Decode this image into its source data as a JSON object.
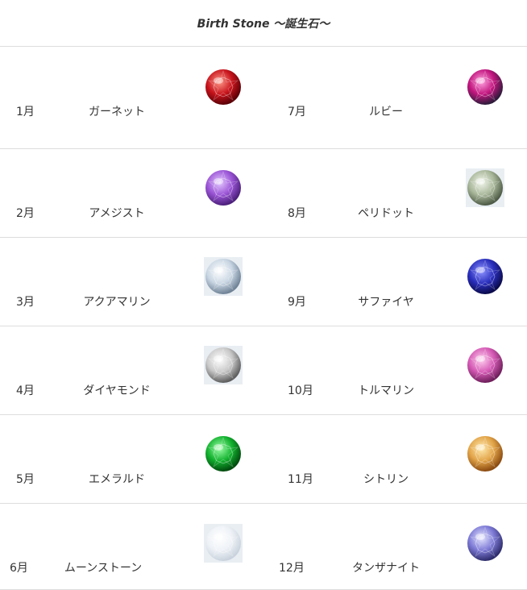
{
  "title": "Birth Stone ～誕生石～",
  "stones": [
    {
      "month": "1月",
      "name": "ガーネット",
      "icon": "garnet-gem-icon",
      "colors": [
        "#ff9a8a",
        "#c8141c",
        "#5a0006"
      ]
    },
    {
      "month": "7月",
      "name": "ルビー",
      "icon": "ruby-gem-icon",
      "colors": [
        "#ffa3e0",
        "#c2157e",
        "#2c1b3a"
      ]
    },
    {
      "month": "2月",
      "name": "アメジスト",
      "icon": "amethyst-gem-icon",
      "colors": [
        "#e4c9ff",
        "#9b55d6",
        "#4b1f7a"
      ]
    },
    {
      "month": "8月",
      "name": "ペリドット",
      "icon": "peridot-gem-icon",
      "colors": [
        "#f2f6ec",
        "#a9b79a",
        "#4d5a45"
      ]
    },
    {
      "month": "3月",
      "name": "アクアマリン",
      "icon": "aquamarine-gem-icon",
      "colors": [
        "#ffffff",
        "#c9d6e3",
        "#6f8296"
      ]
    },
    {
      "month": "9月",
      "name": "サファイヤ",
      "icon": "sapphire-gem-icon",
      "colors": [
        "#8f95ff",
        "#2a2fbd",
        "#0a0a4a"
      ]
    },
    {
      "month": "4月",
      "name": "ダイヤモンド",
      "icon": "diamond-gem-icon",
      "colors": [
        "#ffffff",
        "#c9c9c9",
        "#5e5e5e"
      ]
    },
    {
      "month": "10月",
      "name": "トルマリン",
      "icon": "tourmaline-gem-icon",
      "colors": [
        "#ffd0ef",
        "#d55ab5",
        "#6e1e5b"
      ]
    },
    {
      "month": "5月",
      "name": "エメラルド",
      "icon": "emerald-gem-icon",
      "colors": [
        "#9dffa8",
        "#13b22f",
        "#004a0d"
      ]
    },
    {
      "month": "11月",
      "name": "シトリン",
      "icon": "citrine-gem-icon",
      "colors": [
        "#ffeab0",
        "#e2a448",
        "#8a4a10"
      ]
    },
    {
      "month": "6月",
      "name": "ムーンストーン",
      "icon": "moonstone-gem-icon",
      "colors": [
        "#ffffff",
        "#eef2f7",
        "#c9d2dc"
      ]
    },
    {
      "month": "12月",
      "name": "タンザナイト",
      "icon": "tanzanite-gem-icon",
      "colors": [
        "#e6e6ff",
        "#7d7ad6",
        "#2e2c6b"
      ]
    }
  ]
}
